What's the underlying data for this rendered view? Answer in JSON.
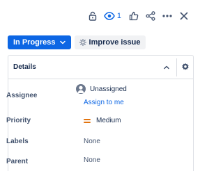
{
  "topbar": {
    "watch_count": "1"
  },
  "actions": {
    "status_label": "In Progress",
    "improve_label": "Improve issue"
  },
  "details": {
    "title": "Details",
    "fields": {
      "assignee": {
        "label": "Assignee",
        "value": "Unassigned",
        "link": "Assign to me"
      },
      "priority": {
        "label": "Priority",
        "value": "Medium"
      },
      "labels": {
        "label": "Labels",
        "value": "None"
      },
      "parent": {
        "label": "Parent",
        "value": "None"
      }
    }
  },
  "colors": {
    "primary": "#0c66e4",
    "priority_medium": "#e2740f",
    "text": "#172b4d",
    "subtle_text": "#44546f",
    "border": "#dcdfe4"
  },
  "icons": [
    "lock-icon",
    "eye-icon",
    "thumbs-up-icon",
    "share-icon",
    "more-icon",
    "close-icon",
    "chevron-down-icon",
    "sparkle-icon",
    "chevron-up-icon",
    "gear-icon",
    "person-avatar-icon",
    "priority-medium-icon"
  ]
}
